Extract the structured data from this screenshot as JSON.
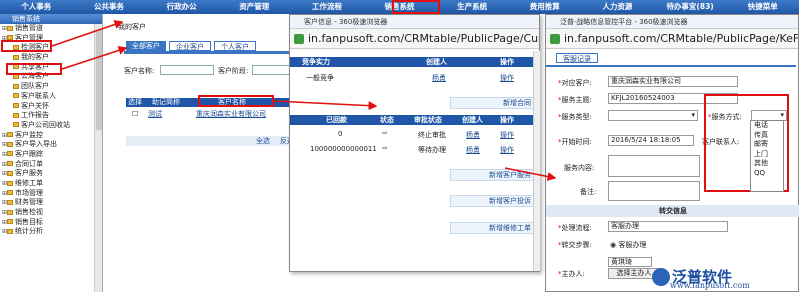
{
  "topnav": [
    "个人事务",
    "公共事务",
    "行政办公",
    "资产管理",
    "工作流程",
    "销售系统",
    "生产系统",
    "费用推算",
    "人力资源",
    "待办事宜(83)",
    "快捷菜单"
  ],
  "left": {
    "header": "销售系统",
    "items": [
      "销售管道",
      "客户管理",
      "检测客户",
      "我的客户",
      "共享客户",
      "公海客户",
      "团队客户",
      "客户联系人",
      "客户关怀",
      "工作报告",
      "客户公司回收站",
      "客户监控",
      "客户导入导出",
      "客户跟踪",
      "合同订单",
      "客户服务",
      "维修工单",
      "市场管理",
      "财务管理",
      "销售检视",
      "销售目标",
      "统计分析"
    ]
  },
  "main": {
    "crumb": "我的客户",
    "tabs": [
      "全部客户",
      "企业客户",
      "个人客户"
    ],
    "name_label": "客户名称:",
    "stage_label": "客户阶段:",
    "grid": {
      "headers": [
        "选择",
        "助记简称",
        "客户名称"
      ],
      "row": {
        "short": "测试",
        "name": "重庆润森实业有限公司"
      }
    },
    "pager": [
      "全选",
      "反选"
    ]
  },
  "pop1": {
    "title": "客户信息 - 360极速浏览器",
    "url": "in.fanpusoft.com/CRMtable/PublicPage/Custon",
    "t1": {
      "headers": [
        "竞争实力",
        "创建人",
        "操作"
      ],
      "row": [
        "一般竞争",
        "杨勇",
        "操作"
      ]
    },
    "btn1": "新增合同",
    "t2": {
      "headers": [
        "已回款",
        "状态",
        "审批状态",
        "创建人",
        "操作"
      ],
      "rows": [
        [
          "0",
          "终止审批",
          "杨勇",
          "操作"
        ],
        [
          "100000000000011",
          "等待办理",
          "杨勇",
          "操作"
        ]
      ]
    },
    "btns": [
      "新增客户服务",
      "新增客户投诉",
      "新增维修工单"
    ]
  },
  "pop2": {
    "title": "泛普·战略信息管控平台 - 360极速浏览器",
    "url": "in.fanpusoft.com/CRMtable/PublicPage/KeFu_add.",
    "tab": "客服记录",
    "fields": {
      "customer_label": "对应客户:",
      "customer": "重庆润森实业有限公司",
      "subject_label": "服务主题:",
      "subject": "KFJL20160524003",
      "type_label": "服务类型:",
      "method_label": "服务方式:",
      "start_label": "开始时间:",
      "start": "2016/5/24 18:18:05",
      "contact_label": "客户联系人:",
      "content_label": "服务内容:",
      "note_label": "备注:",
      "section": "转交信息",
      "flow_label": "处理流程:",
      "flow": "客服办理",
      "step_label": "转交步骤:",
      "step": "客服办理",
      "owner_label": "主办人:",
      "owner": "黄琪琦",
      "owner_btn": "选择主办人"
    },
    "options": [
      "电话",
      "传真",
      "邮寄",
      "上门",
      "其他",
      "QQ"
    ]
  },
  "logo": {
    "cn": "泛普软件",
    "en": "www.fanpusoft.com"
  }
}
